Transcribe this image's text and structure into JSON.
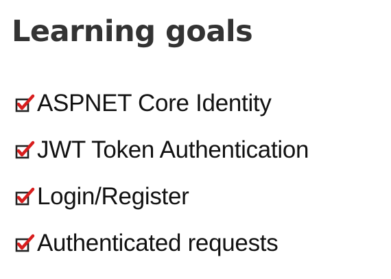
{
  "slide": {
    "title": "Learning goals",
    "goals": [
      {
        "label": "ASPNET Core Identity",
        "checked": true,
        "icon": "checked-box-icon"
      },
      {
        "label": "JWT Token Authentication",
        "checked": true,
        "icon": "checked-box-icon"
      },
      {
        "label": "Login/Register",
        "checked": true,
        "icon": "checked-box-icon"
      },
      {
        "label": "Authenticated requests",
        "checked": true,
        "icon": "checked-box-icon"
      }
    ]
  },
  "colors": {
    "title": "#333333",
    "text": "#111111",
    "checkbox_border": "#222222",
    "check_mark": "#d81e1e"
  }
}
